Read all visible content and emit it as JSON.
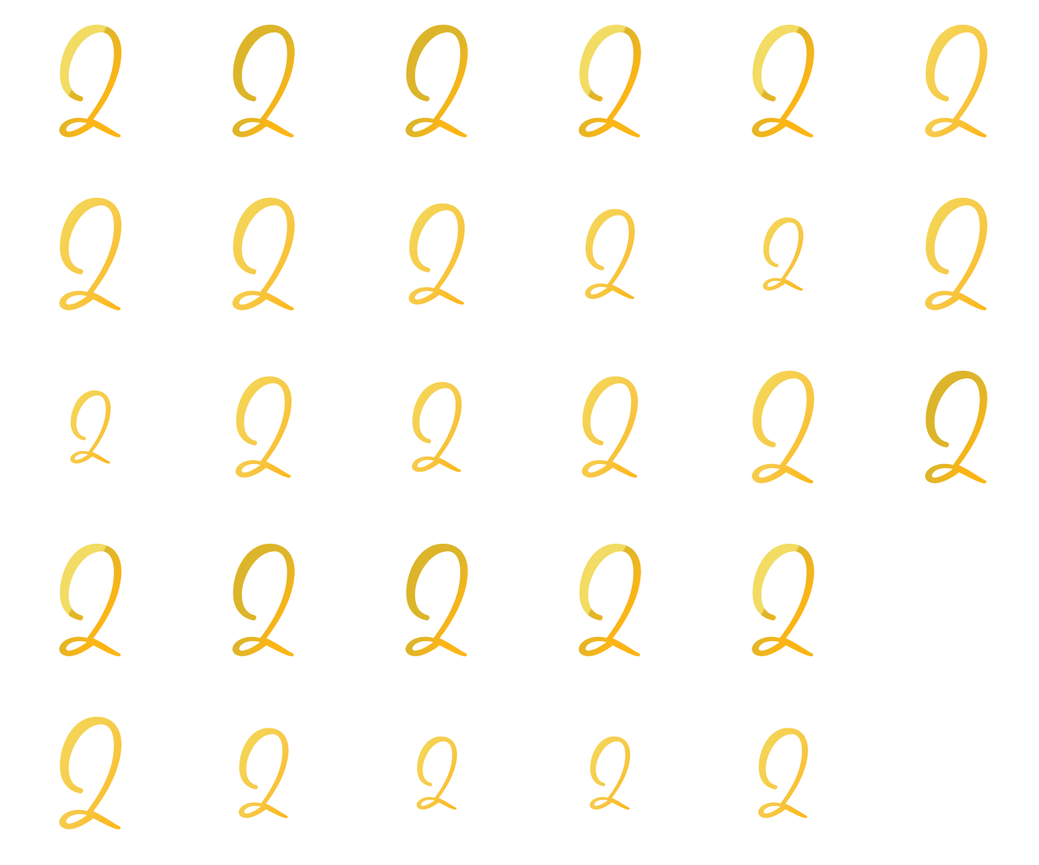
{
  "page": {
    "background": "#ffffff"
  },
  "glyph": {
    "icon": "script-letter-q-icon",
    "colors": {
      "light": "#F4D95A",
      "mid": "#F7C948",
      "deep": "#FDB515",
      "olive_shade": "#DDB52A",
      "shine": "#F2DC64"
    }
  },
  "grid": {
    "columns": 6,
    "rows": [
      [
        {
          "scale": 1.0,
          "style": "glossy"
        },
        {
          "scale": 1.0,
          "style": "dark"
        },
        {
          "scale": 1.0,
          "style": "dark"
        },
        {
          "scale": 1.0,
          "style": "glossy"
        },
        {
          "scale": 1.0,
          "style": "glossy"
        },
        {
          "scale": 1.0,
          "style": "bright"
        }
      ],
      [
        {
          "scale": 1.0,
          "style": "bright"
        },
        {
          "scale": 1.0,
          "style": "bright"
        },
        {
          "scale": 0.9,
          "style": "bright"
        },
        {
          "scale": 0.8,
          "style": "bright"
        },
        {
          "scale": 0.65,
          "style": "bright"
        },
        {
          "scale": 1.0,
          "style": "bright"
        }
      ],
      [
        {
          "scale": 0.65,
          "style": "bright"
        },
        {
          "scale": 0.9,
          "style": "bright"
        },
        {
          "scale": 0.8,
          "style": "bright"
        },
        {
          "scale": 0.9,
          "style": "bright"
        },
        {
          "scale": 1.0,
          "style": "bright"
        },
        {
          "scale": 1.0,
          "style": "dark"
        }
      ],
      [
        {
          "scale": 1.0,
          "style": "glossy"
        },
        {
          "scale": 1.0,
          "style": "dark"
        },
        {
          "scale": 1.0,
          "style": "dark"
        },
        {
          "scale": 1.0,
          "style": "glossy"
        },
        {
          "scale": 1.0,
          "style": "glossy"
        }
      ],
      [
        {
          "scale": 1.0,
          "style": "bright"
        },
        {
          "scale": 0.8,
          "style": "bright"
        },
        {
          "scale": 0.65,
          "style": "bright"
        },
        {
          "scale": 0.65,
          "style": "bright"
        },
        {
          "scale": 0.8,
          "style": "bright"
        }
      ]
    ]
  }
}
